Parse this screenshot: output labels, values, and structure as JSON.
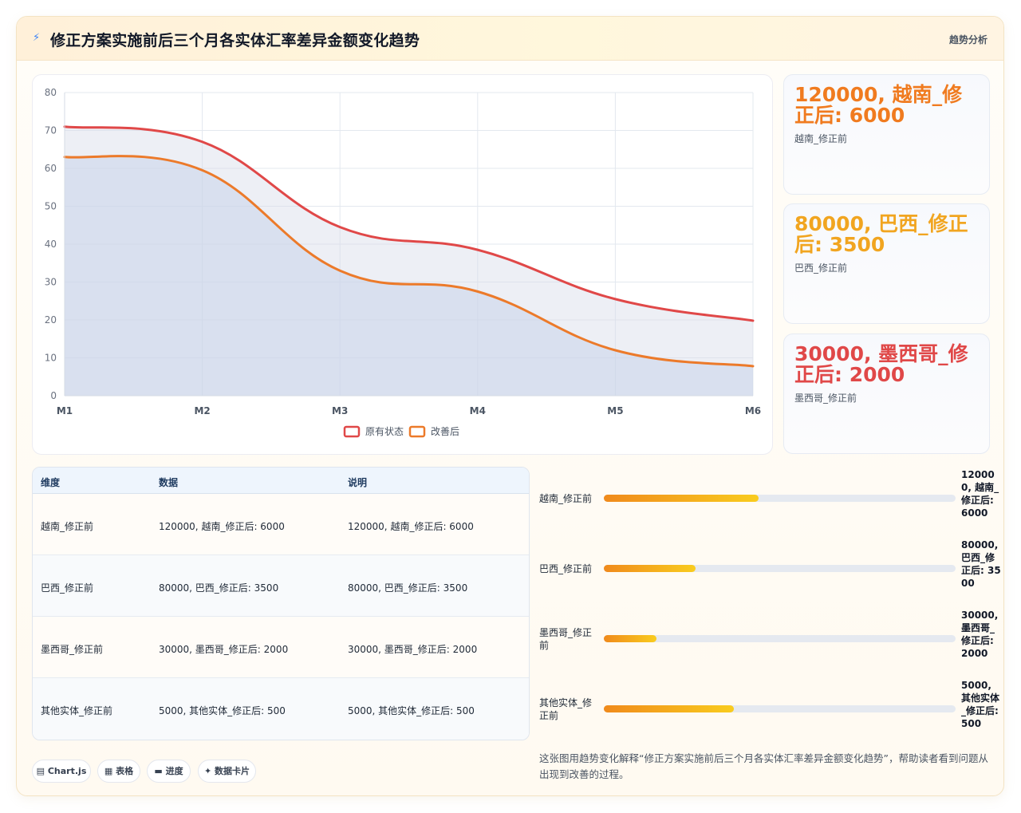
{
  "header": {
    "icon": "lightning-icon",
    "title": "修正方案实施前后三个月各实体汇率差异金额变化趋势",
    "tag": "趋势分析"
  },
  "colors": {
    "red_series": "#e04848",
    "orange_series": "#ec7a2a",
    "kpi_orange": "#f07b1f",
    "kpi_amber": "#f1a520",
    "kpi_red": "#e04848"
  },
  "chart_data": {
    "type": "area",
    "x": [
      "M1",
      "M2",
      "M3",
      "M4",
      "M5",
      "M6"
    ],
    "ylim": [
      0,
      80
    ],
    "yticks": [
      0,
      10,
      20,
      30,
      40,
      50,
      60,
      70,
      80
    ],
    "grid": true,
    "legend_position": "bottom",
    "series": [
      {
        "name": "原有状态",
        "values": [
          71,
          67,
          44.5,
          38.5,
          25.5,
          19.8
        ],
        "color": "#e04848"
      },
      {
        "name": "改善后",
        "values": [
          63,
          59.5,
          33,
          27.5,
          12,
          7.8
        ],
        "color": "#ec7a2a"
      }
    ]
  },
  "kpis": [
    {
      "value": "120000, 越南_修正后: 6000",
      "label": "越南_修正前"
    },
    {
      "value": "80000, 巴西_修正后: 3500",
      "label": "巴西_修正前"
    },
    {
      "value": "30000, 墨西哥_修正后: 2000",
      "label": "墨西哥_修正前"
    }
  ],
  "table": {
    "headers": [
      "维度",
      "数据",
      "说明"
    ],
    "rows": [
      [
        "越南_修正前",
        "120000, 越南_修正后: 6000",
        "120000, 越南_修正后: 6000"
      ],
      [
        "巴西_修正前",
        "80000, 巴西_修正后: 3500",
        "80000, 巴西_修正后: 3500"
      ],
      [
        "墨西哥_修正前",
        "30000, 墨西哥_修正后: 2000",
        "30000, 墨西哥_修正后: 2000"
      ],
      [
        "其他实体_修正前",
        "5000, 其他实体_修正后: 500",
        "5000, 其他实体_修正后: 500"
      ]
    ]
  },
  "progress": [
    {
      "label": "越南_修正前",
      "value": "120000, 越南_修正后: 6000",
      "fraction": 0.44
    },
    {
      "label": "巴西_修正前",
      "value": "80000, 巴西_修正后: 3500",
      "fraction": 0.26
    },
    {
      "label": "墨西哥_修正前",
      "value": "30000, 墨西哥_修正后: 2000",
      "fraction": 0.15
    },
    {
      "label": "其他实体_修正前",
      "value": "5000, 其他实体_修正后: 500",
      "fraction": 0.37
    }
  ],
  "chips": [
    {
      "icon": "chart-icon",
      "glyph": "▤",
      "label": "Chart.js"
    },
    {
      "icon": "table-icon",
      "glyph": "▦",
      "label": "表格"
    },
    {
      "icon": "progress-icon",
      "glyph": "▬",
      "label": "进度"
    },
    {
      "icon": "sparkle-icon",
      "glyph": "✦",
      "label": "数据卡片"
    }
  ],
  "note": "这张图用趋势变化解释“修正方案实施前后三个月各实体汇率差异金额变化趋势”，帮助读者看到问题从出现到改善的过程。"
}
